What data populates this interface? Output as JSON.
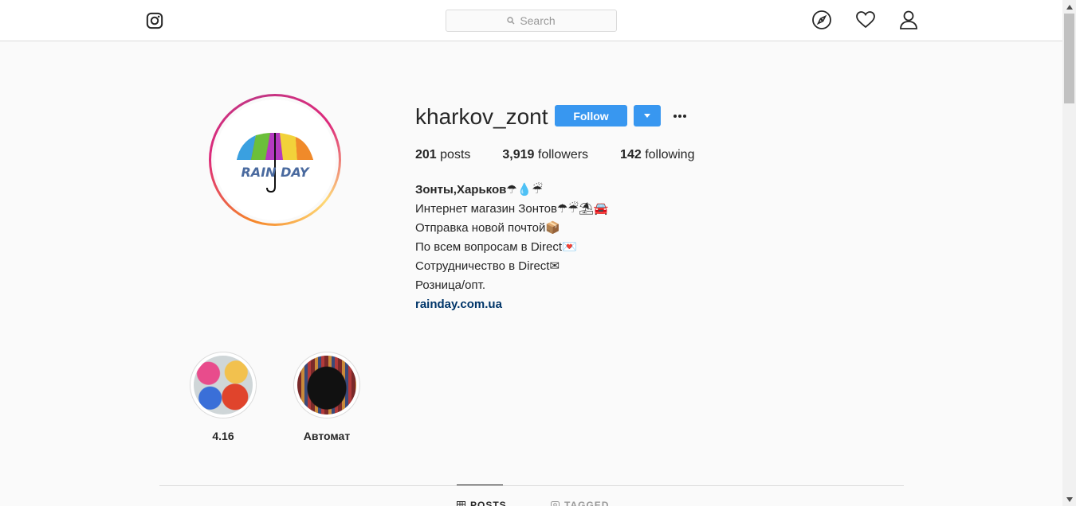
{
  "search": {
    "placeholder": "Search"
  },
  "profile": {
    "username": "kharkov_zont",
    "follow_label": "Follow",
    "avatar_logo_text": "RAIN DAY",
    "stats": [
      {
        "count": "201",
        "label": "posts"
      },
      {
        "count": "3,919",
        "label": "followers"
      },
      {
        "count": "142",
        "label": "following"
      }
    ],
    "bio": {
      "name": "Зонты,Харьков☂💧☔",
      "lines": [
        "Интернет магазин Зонтов☂☔⛱🚘",
        "Отправка новой почтой📦",
        "По всем вопросам в Direct💌",
        "Сотрудничество в Direct✉",
        "Розница/опт."
      ],
      "link": "rainday.com.ua"
    }
  },
  "highlights": [
    {
      "label": "4.16"
    },
    {
      "label": "Автомат"
    }
  ],
  "tabs": [
    {
      "label": "POSTS",
      "active": true
    },
    {
      "label": "TAGGED",
      "active": false
    }
  ],
  "colors": {
    "accent": "#3897f0",
    "link": "#003569",
    "border": "#dbdbdb"
  }
}
